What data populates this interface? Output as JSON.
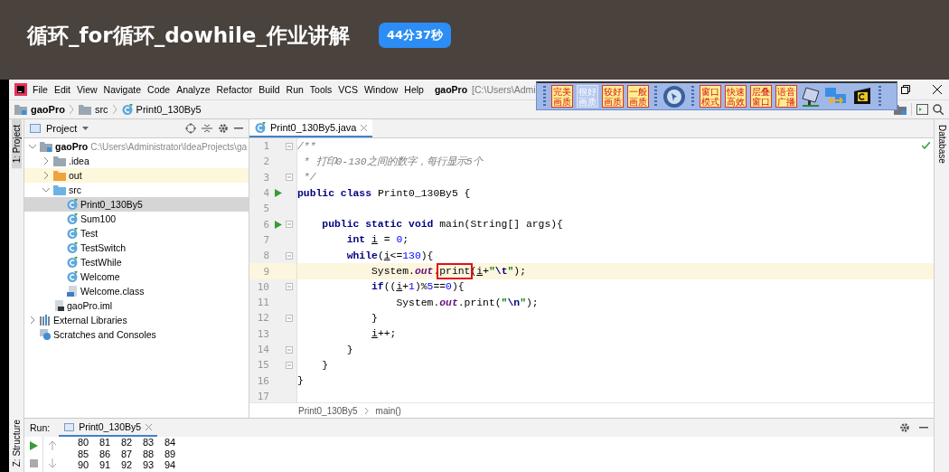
{
  "header": {
    "title": "循环_for循环_dowhile_作业讲解",
    "timer": "44分37秒"
  },
  "menu": {
    "items": [
      "File",
      "Edit",
      "View",
      "Navigate",
      "Code",
      "Analyze",
      "Refactor",
      "Build",
      "Run",
      "Tools",
      "VCS",
      "Window",
      "Help"
    ],
    "project_title": "gaoPro",
    "path": "[C:\\Users\\Admi"
  },
  "overlay_toolbar": {
    "buttons": [
      {
        "label": "完美画质",
        "disabled": false
      },
      {
        "label": "很好画质",
        "disabled": true
      },
      {
        "label": "较好画质",
        "disabled": false
      },
      {
        "label": "一般画质",
        "disabled": false
      },
      {
        "label": "窗口模式",
        "disabled": false
      },
      {
        "label": "快速高效",
        "disabled": false
      },
      {
        "label": "层叠窗口",
        "disabled": false
      },
      {
        "label": "语音广播",
        "disabled": false
      }
    ]
  },
  "breadcrumbs": [
    {
      "label": "gaoPro",
      "kind": "module"
    },
    {
      "label": "src",
      "kind": "folder"
    },
    {
      "label": "Print0_130By5",
      "kind": "class"
    }
  ],
  "side_tabs": {
    "left": [
      "1: Project",
      "Z: Structure"
    ],
    "right": [
      "Database"
    ]
  },
  "project_panel": {
    "title": "Project",
    "tree": [
      {
        "label": "gaoPro",
        "path": "C:\\Users\\Administrator\\IdeaProjects\\ga",
        "kind": "module",
        "expanded": true,
        "selected": false,
        "children": [
          {
            "label": ".idea",
            "kind": "folder",
            "expanded": false,
            "selected": false
          },
          {
            "label": "out",
            "kind": "excluded",
            "expanded": false,
            "selected": false
          },
          {
            "label": "src",
            "kind": "source",
            "expanded": true,
            "selected": false,
            "children": [
              {
                "label": "Print0_130By5",
                "kind": "class",
                "selected": true
              },
              {
                "label": "Sum100",
                "kind": "class",
                "selected": false
              },
              {
                "label": "Test",
                "kind": "class",
                "selected": false
              },
              {
                "label": "TestSwitch",
                "kind": "class",
                "selected": false
              },
              {
                "label": "TestWhile",
                "kind": "class",
                "selected": false
              },
              {
                "label": "Welcome",
                "kind": "class",
                "selected": false
              },
              {
                "label": "Welcome.class",
                "kind": "classfile",
                "selected": false
              }
            ]
          },
          {
            "label": "gaoPro.iml",
            "kind": "iml",
            "selected": false
          }
        ]
      },
      {
        "label": "External Libraries",
        "kind": "libraries",
        "expanded": false,
        "selected": false
      },
      {
        "label": "Scratches and Consoles",
        "kind": "scratches",
        "selected": false
      }
    ]
  },
  "editor": {
    "tab": {
      "label": "Print0_130By5.java",
      "selected": true
    },
    "lines": [
      {
        "number": "1",
        "fold": true,
        "run": false,
        "current": false,
        "tokens": [
          {
            "kind": "comment",
            "text": "/**"
          }
        ]
      },
      {
        "number": "2",
        "fold": false,
        "run": false,
        "current": false,
        "tokens": [
          {
            "kind": "comment",
            "text": " * 打印0-130之间的数字，每行显示5个"
          }
        ]
      },
      {
        "number": "3",
        "fold": true,
        "run": false,
        "current": false,
        "tokens": [
          {
            "kind": "comment",
            "text": " */"
          }
        ]
      },
      {
        "number": "4",
        "fold": false,
        "run": true,
        "current": false,
        "tokens": [
          {
            "kind": "keyword",
            "text": "public class"
          },
          {
            "kind": "plain",
            "text": " Print0_130By5 {"
          }
        ]
      },
      {
        "number": "5",
        "fold": false,
        "run": false,
        "current": false
      },
      {
        "number": "6",
        "fold": true,
        "run": true,
        "current": false,
        "tokens": [
          {
            "kind": "keyword",
            "text": "    public static void"
          },
          {
            "kind": "plain",
            "text": " main(String[] args){"
          }
        ]
      },
      {
        "number": "7",
        "fold": false,
        "run": false,
        "current": false,
        "tokens": [
          {
            "kind": "keyword",
            "text": "        int"
          },
          {
            "kind": "var",
            "text": " i"
          },
          {
            "kind": "plain",
            "text": " = "
          },
          {
            "kind": "number",
            "text": "0"
          },
          {
            "kind": "plain",
            "text": ";"
          }
        ]
      },
      {
        "number": "8",
        "fold": true,
        "run": false,
        "current": false,
        "tokens": [
          {
            "kind": "keyword",
            "text": "        while"
          },
          {
            "kind": "plain",
            "text": "("
          },
          {
            "kind": "var",
            "text": "i"
          },
          {
            "kind": "plain",
            "text": "<="
          },
          {
            "kind": "number",
            "text": "130"
          },
          {
            "kind": "plain",
            "text": "){"
          }
        ]
      },
      {
        "number": "9",
        "fold": false,
        "run": false,
        "current": true,
        "tokens": [
          {
            "kind": "plain",
            "text": "            System."
          },
          {
            "kind": "field",
            "text": "out"
          },
          {
            "kind": "plain",
            "text": "."
          },
          {
            "kind": "boxed",
            "text": "print"
          },
          {
            "kind": "plain",
            "text": "("
          },
          {
            "kind": "var",
            "text": "i"
          },
          {
            "kind": "plain",
            "text": "+"
          },
          {
            "kind": "string",
            "text": "\""
          },
          {
            "kind": "escape",
            "text": "\\t"
          },
          {
            "kind": "string",
            "text": "\""
          },
          {
            "kind": "plain",
            "text": ");"
          }
        ]
      },
      {
        "number": "10",
        "fold": true,
        "run": false,
        "current": false,
        "tokens": [
          {
            "kind": "keyword",
            "text": "            if"
          },
          {
            "kind": "plain",
            "text": "(("
          },
          {
            "kind": "var",
            "text": "i"
          },
          {
            "kind": "plain",
            "text": "+"
          },
          {
            "kind": "number",
            "text": "1"
          },
          {
            "kind": "plain",
            "text": ")%"
          },
          {
            "kind": "number",
            "text": "5"
          },
          {
            "kind": "plain",
            "text": "=="
          },
          {
            "kind": "number",
            "text": "0"
          },
          {
            "kind": "plain",
            "text": "){"
          }
        ]
      },
      {
        "number": "11",
        "fold": false,
        "run": false,
        "current": false,
        "tokens": [
          {
            "kind": "plain",
            "text": "                System."
          },
          {
            "kind": "field",
            "text": "out"
          },
          {
            "kind": "plain",
            "text": ".print("
          },
          {
            "kind": "string",
            "text": "\""
          },
          {
            "kind": "escape",
            "text": "\\n"
          },
          {
            "kind": "string",
            "text": "\""
          },
          {
            "kind": "plain",
            "text": ");"
          }
        ]
      },
      {
        "number": "12",
        "fold": true,
        "run": false,
        "current": false,
        "tokens": [
          {
            "kind": "plain",
            "text": "            }"
          }
        ]
      },
      {
        "number": "13",
        "fold": false,
        "run": false,
        "current": false,
        "tokens": [
          {
            "kind": "var",
            "text": "            i"
          },
          {
            "kind": "plain",
            "text": "++;"
          }
        ]
      },
      {
        "number": "14",
        "fold": true,
        "run": false,
        "current": false,
        "tokens": [
          {
            "kind": "plain",
            "text": "        }"
          }
        ]
      },
      {
        "number": "15",
        "fold": true,
        "run": false,
        "current": false,
        "tokens": [
          {
            "kind": "plain",
            "text": "    }"
          }
        ]
      },
      {
        "number": "16",
        "fold": false,
        "run": false,
        "current": false,
        "tokens": [
          {
            "kind": "plain",
            "text": "}"
          }
        ]
      },
      {
        "number": "17",
        "fold": false,
        "run": false,
        "current": false
      }
    ],
    "breadcrumbs": [
      "Print0_130By5",
      "main()"
    ]
  },
  "run": {
    "label": "Run:",
    "tab": {
      "label": "Print0_130By5",
      "selected": true
    },
    "output": [
      [
        "80",
        "81",
        "82",
        "83",
        "84"
      ],
      [
        "85",
        "86",
        "87",
        "88",
        "89"
      ],
      [
        "90",
        "91",
        "92",
        "93",
        "94"
      ]
    ]
  }
}
